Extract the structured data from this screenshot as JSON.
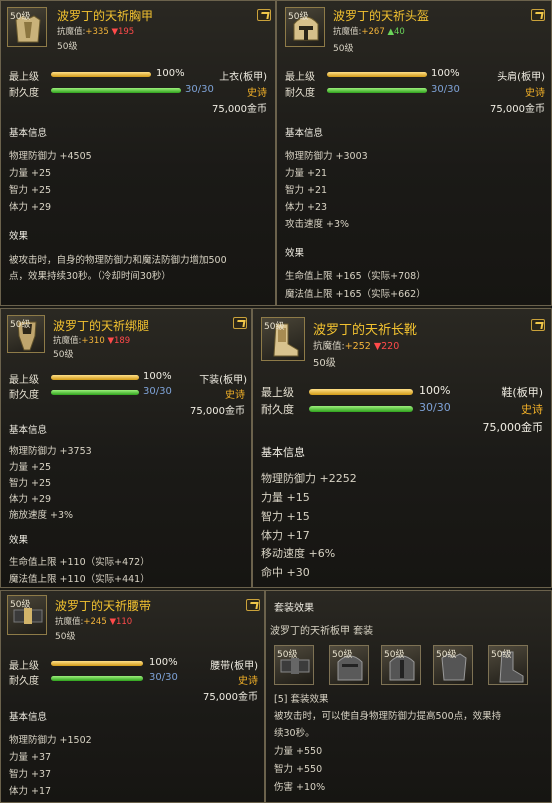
{
  "common": {
    "max_level_label": "最上级",
    "durability_label": "耐久度",
    "level_tag": "50级",
    "required_level": "50级",
    "base_info": "基本信息",
    "effect": "效果",
    "resist_label": "抗魔值:",
    "rarity": "史诗",
    "price": "75,000金币"
  },
  "chest": {
    "name": "波罗丁的天祈胸甲",
    "resist_value": "+335",
    "resist_delta": "▼195",
    "max_pct": "100%",
    "max_fill": 1.0,
    "durability": "30/30",
    "slot": "上衣(板甲)",
    "stats": [
      "物理防御力 +4505",
      "力量 +25",
      "智力 +25",
      "体力 +29"
    ],
    "effect_text": [
      "被攻击时，自身的物理防御力和魔法防御力增加500",
      "点，效果持续30秒。（冷却时间30秒）"
    ]
  },
  "helm": {
    "name": "波罗丁的天祈头盔",
    "resist_value": "+267",
    "resist_delta": "▲40",
    "max_pct": "100%",
    "max_fill": 1.0,
    "durability": "30/30",
    "slot": "头肩(板甲)",
    "stats": [
      "物理防御力 +3003",
      "力量 +21",
      "智力 +21",
      "体力 +23",
      "攻击速度 +3%"
    ],
    "effect_lines": [
      "生命值上限 +165（实际+708）",
      "魔法值上限 +165（实际+662）"
    ]
  },
  "legs": {
    "name": "波罗丁的天祈绑腿",
    "resist_value": "+310",
    "resist_delta": "▼189",
    "max_pct": "100%",
    "max_fill": 1.0,
    "durability": "30/30",
    "slot": "下装(板甲)",
    "stats": [
      "物理防御力 +3753",
      "力量 +25",
      "智力 +25",
      "体力 +29",
      "施放速度 +3%"
    ],
    "effect_lines": [
      "生命值上限 +110（实际+472）",
      "魔法值上限 +110（实际+441）"
    ]
  },
  "boots": {
    "name": "波罗丁的天祈长靴",
    "resist_value": "+252",
    "resist_delta": "▼220",
    "max_pct": "100%",
    "max_fill": 1.0,
    "durability": "30/30",
    "slot": "鞋(板甲)",
    "stats": [
      "物理防御力 +2252",
      "力量 +15",
      "智力 +15",
      "体力 +17",
      "移动速度 +6%",
      "命中 +30"
    ]
  },
  "belt": {
    "name": "波罗丁的天祈腰带",
    "resist_value": "+245",
    "resist_delta": "▼110",
    "max_pct": "100%",
    "max_fill": 1.0,
    "durability": "30/30",
    "slot": "腰带(板甲)",
    "stats": [
      "物理防御力 +1502",
      "力量 +37",
      "智力 +37",
      "体力 +17"
    ]
  },
  "set": {
    "title": "套装效果",
    "set_name": "波罗丁的天祈板甲  套装",
    "icon_level": "50级",
    "icons": [
      "belt-icon",
      "helm-icon",
      "helm-icon",
      "chest-icon",
      "boots-icon"
    ],
    "bonus_title": "[5] 套装效果",
    "bonus_text": [
      "被攻击时，可以使自身物理防御力提高500点，效果持",
      "续30秒。"
    ],
    "bonus_stats": [
      "力量 +550",
      "智力 +550",
      "伤害 +10%"
    ]
  },
  "colors": {
    "gold": "#f2c230",
    "epic": "#f3b128",
    "durability": "#7ea2d6",
    "down": "#ff4a4a",
    "up": "#6bd45a"
  }
}
